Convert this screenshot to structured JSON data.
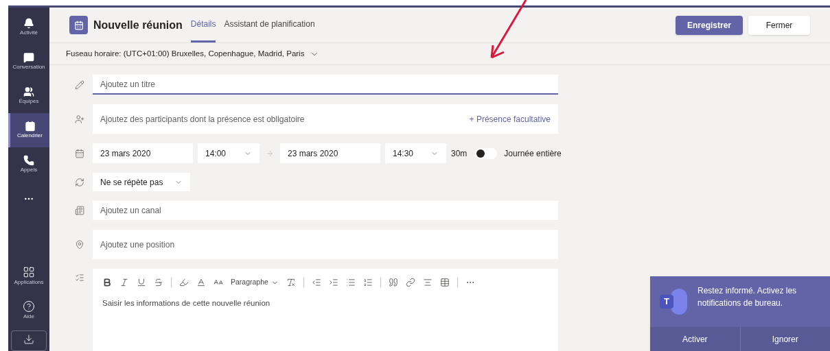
{
  "sidebar": {
    "items": [
      {
        "label": "Activité",
        "selected": false
      },
      {
        "label": "Conversation",
        "selected": false
      },
      {
        "label": "Équipes",
        "selected": false
      },
      {
        "label": "Calendrier",
        "selected": true
      },
      {
        "label": "Appels",
        "selected": false
      },
      {
        "selected": false
      }
    ],
    "bottom_items": [
      {
        "label": "Applications"
      },
      {
        "label": "Aide"
      }
    ]
  },
  "header": {
    "title": "Nouvelle réunion",
    "tabs": [
      {
        "label": "Détails",
        "selected": true
      },
      {
        "label": "Assistant de planification",
        "selected": false
      }
    ],
    "buttons": [
      {
        "label": "Enregistrer",
        "kind": "primary"
      },
      {
        "label": "Fermer",
        "kind": "secondary"
      }
    ]
  },
  "timezone": "Fuseau horaire: (UTC+01:00) Bruxelles, Copenhague, Madrid, Paris",
  "form": {
    "title_field": {
      "placeholder": "Ajoutez un titre"
    },
    "attendees_field": {
      "placeholder": "Ajoutez des participants dont la présence est obligatoire",
      "optional_link": "+ Présence facultative"
    },
    "schedule": {
      "start_date": "23 mars 2020",
      "start_time": "14:00",
      "end_date": "23 mars 2020",
      "end_time": "14:30",
      "duration": "30m",
      "all_day": {
        "label": "Journée entière",
        "on": false
      }
    },
    "recurrence": {
      "value": "Ne se répète pas"
    },
    "channel_field": {
      "placeholder": "Ajoutez un canal"
    },
    "location_field": {
      "placeholder": "Ajoutez une position"
    },
    "editor": {
      "paragraph_style": "Paragraphe",
      "placeholder": "Saisir les informations de cette nouvelle réunion"
    }
  },
  "toast": {
    "logo_letter": "T",
    "message": "Restez informé. Activez les notifications de bureau.",
    "buttons": [
      "Activer",
      "Ignorer"
    ]
  }
}
